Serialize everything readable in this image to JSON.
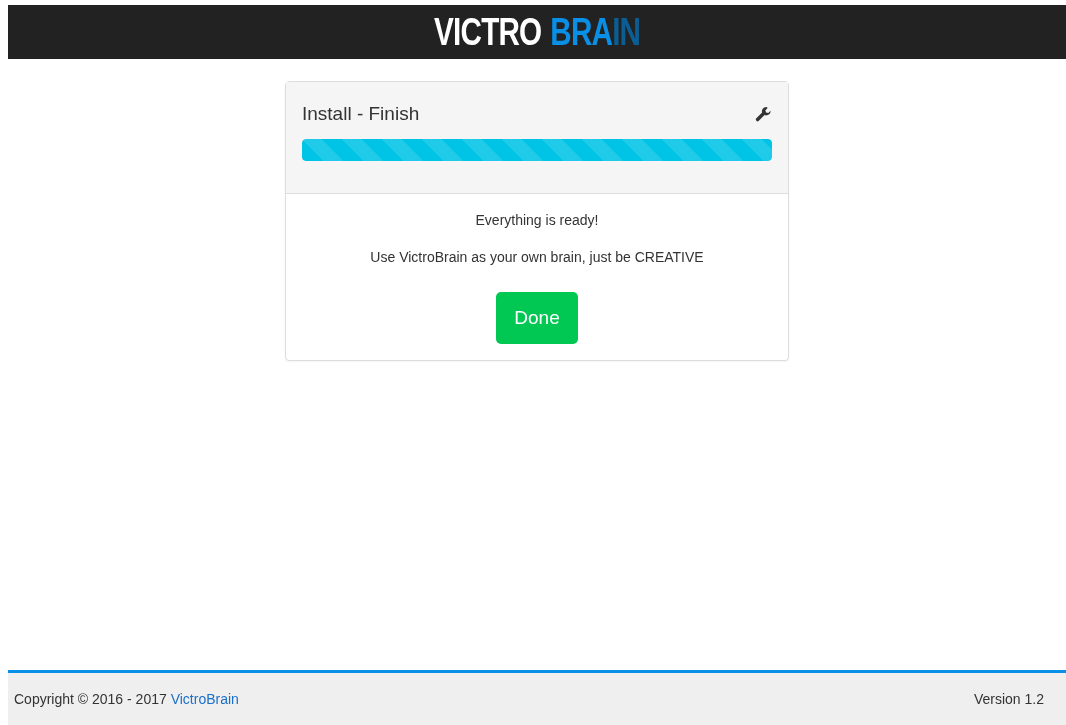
{
  "header": {
    "logo": [
      {
        "text": "VICTRO",
        "color": "#ffffff"
      },
      {
        "text": "BRA",
        "color": "#0a8fe6"
      },
      {
        "text": "IN",
        "color": "#0b5e94"
      }
    ]
  },
  "panel": {
    "title": "Install - Finish",
    "progress": {
      "level": 1
    },
    "messages": [
      "Everything is ready!",
      "Use VictroBrain as your own brain, just be CREATIVE"
    ],
    "button": "Done"
  },
  "footer": {
    "copyright": "Copyright © 2016 - 2017",
    "link": "VictroBrain",
    "version": "Version 1.2"
  }
}
